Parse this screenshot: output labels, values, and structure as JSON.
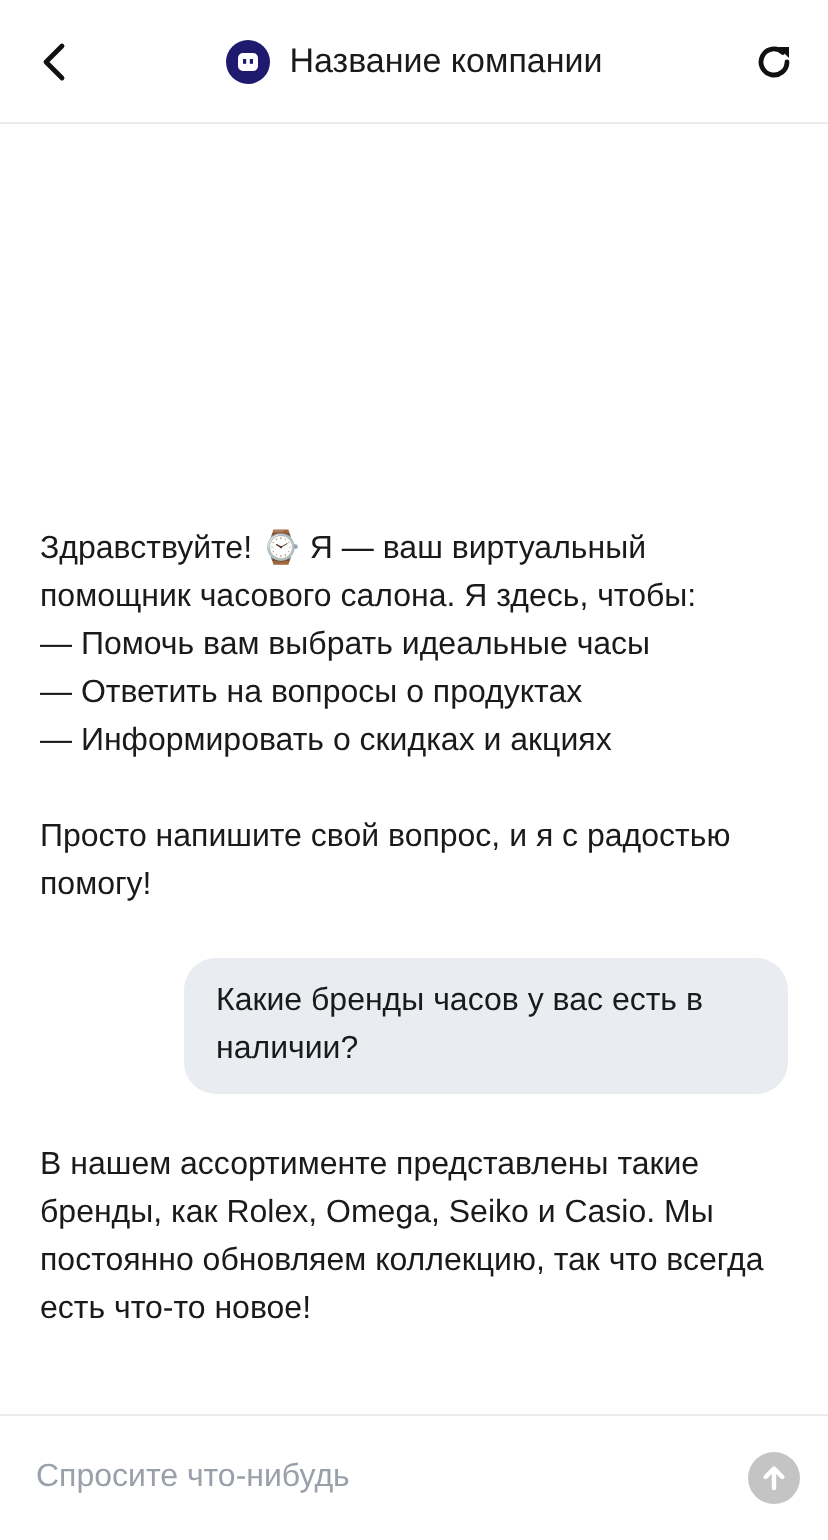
{
  "header": {
    "title": "Название компании"
  },
  "messages": [
    {
      "kind": "bot",
      "paragraphs": [
        "Здравствуйте! ⌚ Я — ваш виртуальный помощник часового салона. Я здесь, чтобы:\n— Помочь вам выбрать идеальные часы\n— Ответить на вопросы о продуктах\n— Информировать о скидках и акциях",
        "Просто напишите свой вопрос, и я с радостью помогу!"
      ]
    },
    {
      "kind": "user",
      "paragraphs": [
        "Какие бренды часов у вас есть в наличии?"
      ]
    },
    {
      "kind": "bot",
      "paragraphs": [
        "В нашем ассортименте представлены такие бренды, как Rolex, Omega, Seiko и Casio. Мы постоянно обновляем коллекцию, так что всегда есть что-то новое!"
      ]
    }
  ],
  "composer": {
    "placeholder": "Спросите что-нибудь",
    "send_disabled": true
  }
}
